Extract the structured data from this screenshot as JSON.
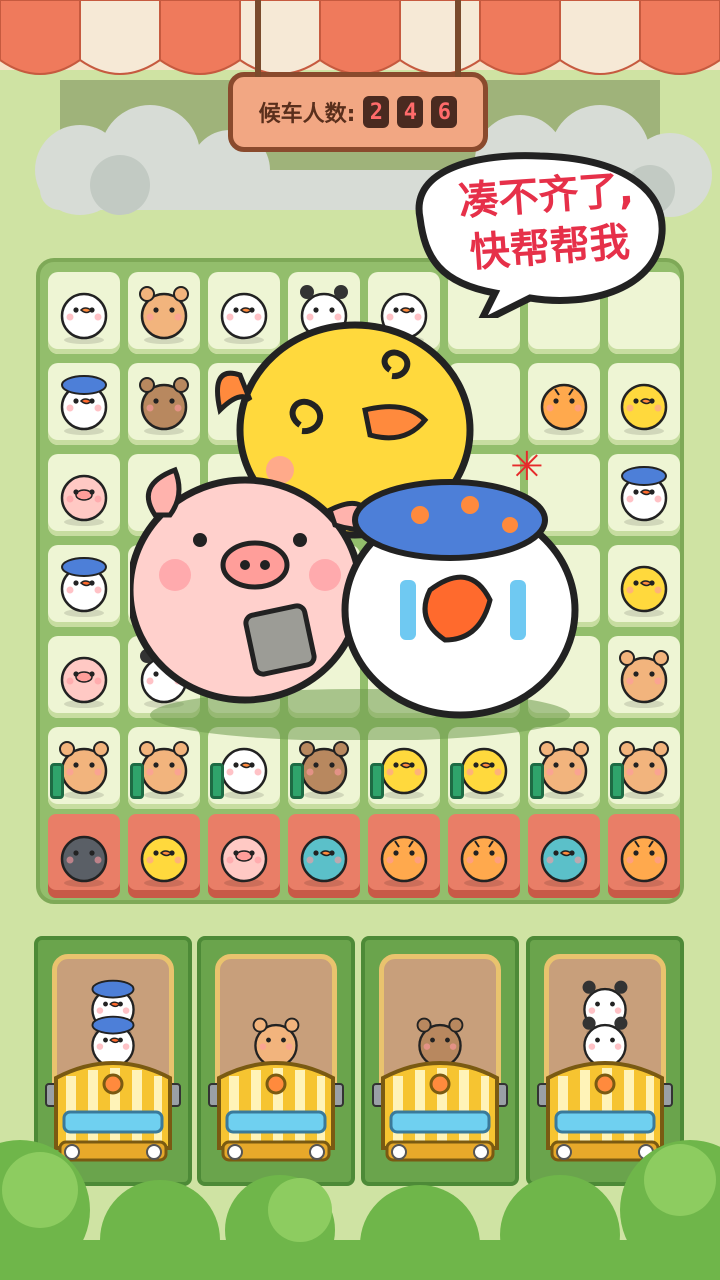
{
  "counter": {
    "label": "候车人数:",
    "digits": [
      "2",
      "4",
      "6"
    ]
  },
  "speech_bubble": {
    "line1": "凑不齐了,",
    "line2": "快帮帮我"
  },
  "board": {
    "rows": [
      [
        "chick-white",
        "hamster",
        "chick-white",
        "panda",
        "chick-white",
        "empty",
        "empty",
        "empty"
      ],
      [
        "duck-hat",
        "bear",
        "empty",
        "empty",
        "empty",
        "empty",
        "tiger",
        "chick-yellow"
      ],
      [
        "pig",
        "empty",
        "empty",
        "empty",
        "empty",
        "empty",
        "empty",
        "duck-hat"
      ],
      [
        "duck-hat",
        "empty",
        "empty",
        "empty",
        "empty",
        "empty",
        "empty",
        "chick-yellow"
      ],
      [
        "pig",
        "panda",
        "empty",
        "empty",
        "empty",
        "empty",
        "empty",
        "hamster"
      ],
      [
        "hamster",
        "hamster",
        "chick-white",
        "bear",
        "chick-yellow",
        "chick-yellow",
        "hamster",
        "hamster"
      ]
    ],
    "seat_row": [
      "husky",
      "chick-yellow",
      "pig",
      "fish",
      "tiger",
      "tiger",
      "fish",
      "tiger"
    ]
  },
  "buses": [
    {
      "passengers": [
        "duck-hat",
        "duck-hat"
      ]
    },
    {
      "passengers": [
        "hamster"
      ]
    },
    {
      "passengers": [
        "bear"
      ]
    },
    {
      "passengers": [
        "panda",
        "panda"
      ]
    }
  ],
  "colors": {
    "accent_red": "#e63049",
    "board_green": "#93be6c",
    "tile": "#eef5d4",
    "seat": "#e97e67",
    "bus_yellow": "#f6c431"
  }
}
